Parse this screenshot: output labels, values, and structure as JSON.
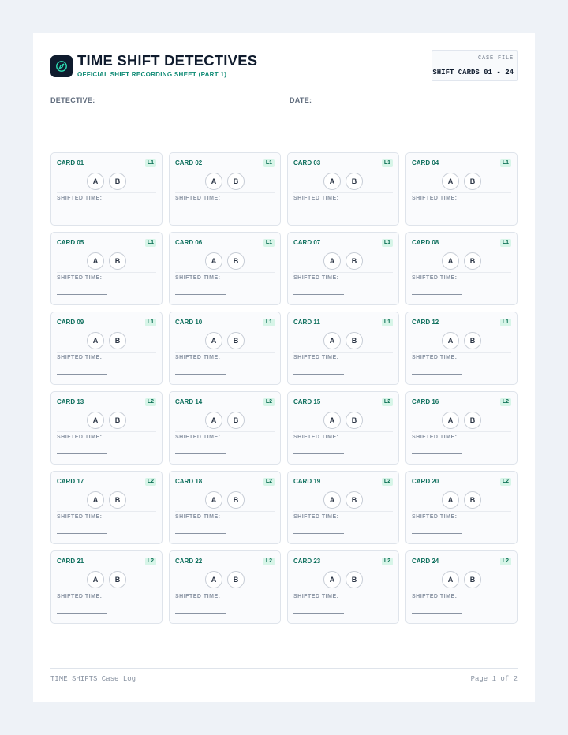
{
  "header": {
    "title": "TIME SHIFT DETECTIVES",
    "subtitle": "OFFICIAL SHIFT RECORDING SHEET (PART 1)",
    "logo_icon": "compass-icon",
    "case_file_label": "CASE FILE",
    "case_file_value": "SHIFT CARDS 01 - 24"
  },
  "fields": {
    "detective_label": "DETECTIVE:",
    "date_label": "DATE:"
  },
  "card_template": {
    "option_a": "A",
    "option_b": "B",
    "shifted_time_label": "SHIFTED TIME:"
  },
  "cards": [
    {
      "title": "CARD 01",
      "level": "L1"
    },
    {
      "title": "CARD 02",
      "level": "L1"
    },
    {
      "title": "CARD 03",
      "level": "L1"
    },
    {
      "title": "CARD 04",
      "level": "L1"
    },
    {
      "title": "CARD 05",
      "level": "L1"
    },
    {
      "title": "CARD 06",
      "level": "L1"
    },
    {
      "title": "CARD 07",
      "level": "L1"
    },
    {
      "title": "CARD 08",
      "level": "L1"
    },
    {
      "title": "CARD 09",
      "level": "L1"
    },
    {
      "title": "CARD 10",
      "level": "L1"
    },
    {
      "title": "CARD 11",
      "level": "L1"
    },
    {
      "title": "CARD 12",
      "level": "L1"
    },
    {
      "title": "CARD 13",
      "level": "L2"
    },
    {
      "title": "CARD 14",
      "level": "L2"
    },
    {
      "title": "CARD 15",
      "level": "L2"
    },
    {
      "title": "CARD 16",
      "level": "L2"
    },
    {
      "title": "CARD 17",
      "level": "L2"
    },
    {
      "title": "CARD 18",
      "level": "L2"
    },
    {
      "title": "CARD 19",
      "level": "L2"
    },
    {
      "title": "CARD 20",
      "level": "L2"
    },
    {
      "title": "CARD 21",
      "level": "L2"
    },
    {
      "title": "CARD 22",
      "level": "L2"
    },
    {
      "title": "CARD 23",
      "level": "L2"
    },
    {
      "title": "CARD 24",
      "level": "L2"
    }
  ],
  "footer": {
    "left": "TIME SHIFTS Case Log",
    "right": "Page 1 of 2"
  },
  "colors": {
    "accent": "#0e8a74",
    "ink": "#0f1b2d",
    "badge_bg": "#d7f5e8"
  }
}
